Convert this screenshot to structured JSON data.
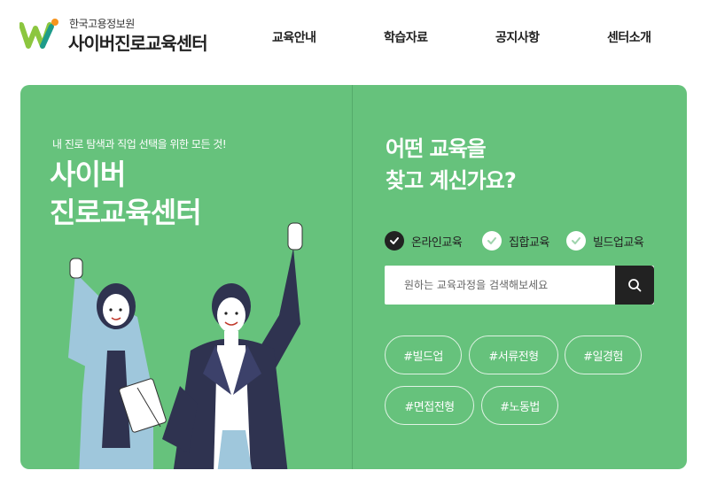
{
  "header": {
    "logo_sub": "한국고용정보원",
    "logo_main": "사이버진로교육센터",
    "nav": [
      "교육안내",
      "학습자료",
      "공지사항",
      "센터소개"
    ]
  },
  "hero": {
    "subtitle": "내 진로 탐색과 직업 선택을 위한 모든 것!",
    "title_line1": "사이버",
    "title_line2": "진로교육센터",
    "question_line1": "어떤 교육을",
    "question_line2": "찾고 계신가요?",
    "options": [
      {
        "label": "온라인교육",
        "checked": true
      },
      {
        "label": "집합교육",
        "checked": false
      },
      {
        "label": "빌드업교육",
        "checked": false
      }
    ],
    "search": {
      "placeholder": "원하는 교육과정을 검색해보세요",
      "value": ""
    },
    "tags": [
      "#빌드업",
      "#서류전형",
      "#일경험",
      "#면접전형",
      "#노동법"
    ]
  },
  "colors": {
    "accent": "#66c27c",
    "dark": "#222222",
    "navy": "#2f3350"
  },
  "icons": {
    "search": "search-icon",
    "check": "check-icon"
  }
}
